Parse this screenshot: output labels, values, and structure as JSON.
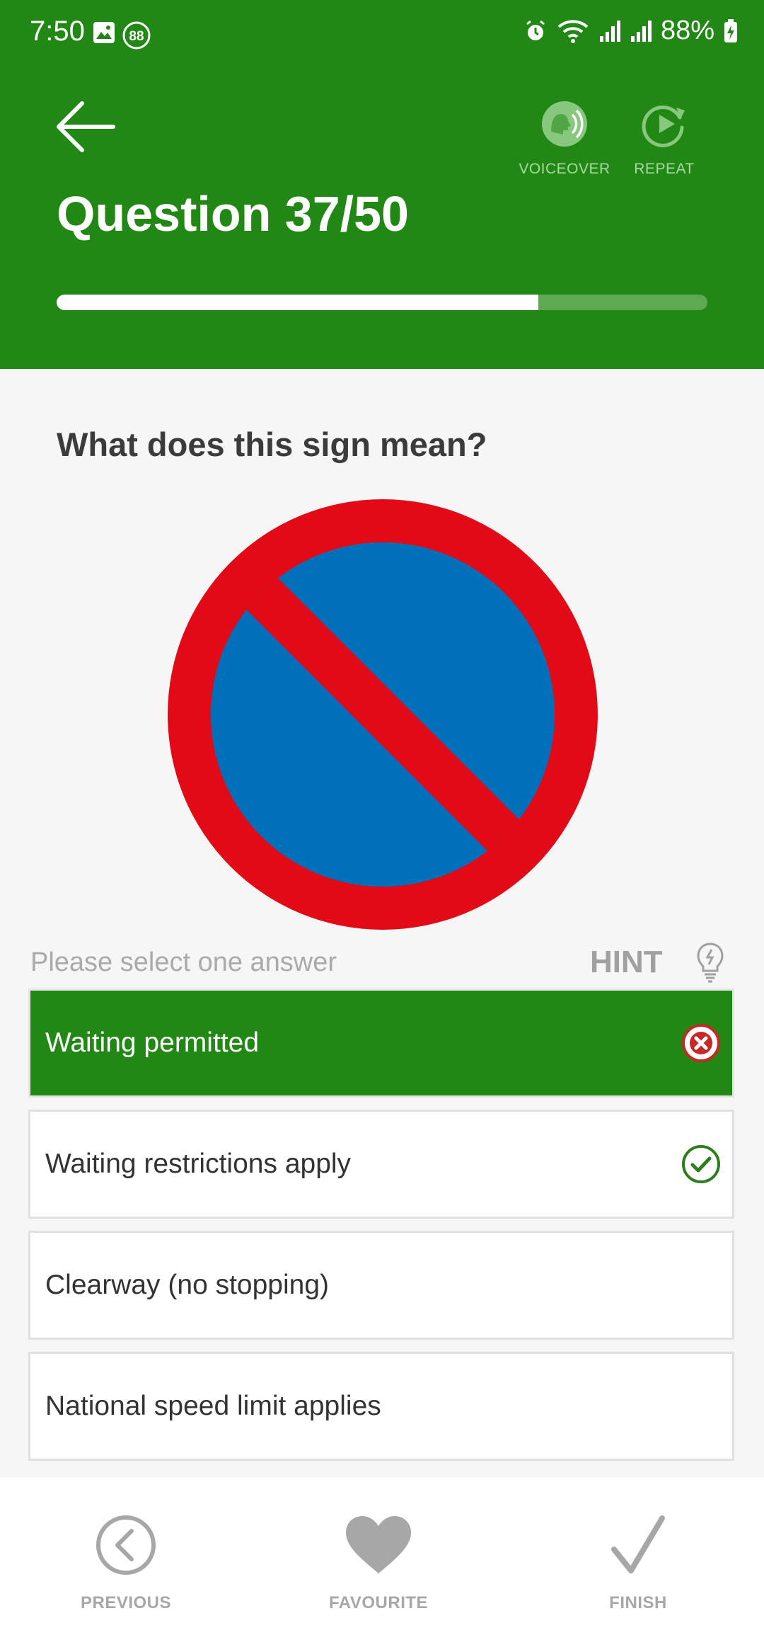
{
  "status_bar": {
    "time": "7:50",
    "notification_badge": "88",
    "battery": "88%"
  },
  "header": {
    "title": "Question 37/50",
    "voiceover_label": "VOICEOVER",
    "repeat_label": "REPEAT",
    "progress_fraction": 0.74
  },
  "question": {
    "text": "What does this sign mean?",
    "sign_icon": "no-waiting-sign"
  },
  "answers_header": {
    "instruction": "Please select one answer",
    "hint_label": "HINT"
  },
  "answers": [
    {
      "text": "Waiting permitted",
      "selected": true,
      "mark": "wrong"
    },
    {
      "text": "Waiting restrictions apply",
      "selected": false,
      "mark": "correct"
    },
    {
      "text": "Clearway (no stopping)",
      "selected": false,
      "mark": ""
    },
    {
      "text": "National speed limit applies",
      "selected": false,
      "mark": ""
    }
  ],
  "footer": {
    "previous_label": "PREVIOUS",
    "favourite_label": "FAVOURITE",
    "finish_label": "FINISH"
  },
  "colors": {
    "header_green": "#228815",
    "selected_green": "#228815",
    "sign_red": "#e20a16",
    "sign_blue": "#0070bb",
    "wrong_red": "#c62828",
    "correct_green": "#2e7d1f"
  }
}
